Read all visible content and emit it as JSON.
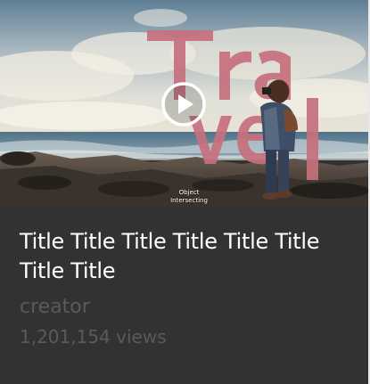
{
  "video": {
    "thumbnail": {
      "overlay_word": "Travel",
      "overlay_word_color": "#c6707d",
      "caption_line1": "Object",
      "caption_line2": "Intersecting",
      "play_icon": "play-icon"
    },
    "title": "Title Title Title Title Title Title Title Title",
    "creator": "creator",
    "views": "1,201,154 views"
  },
  "colors": {
    "card_background": "#323232",
    "title_text": "#ffffff",
    "meta_text": "#5a5a5a"
  }
}
